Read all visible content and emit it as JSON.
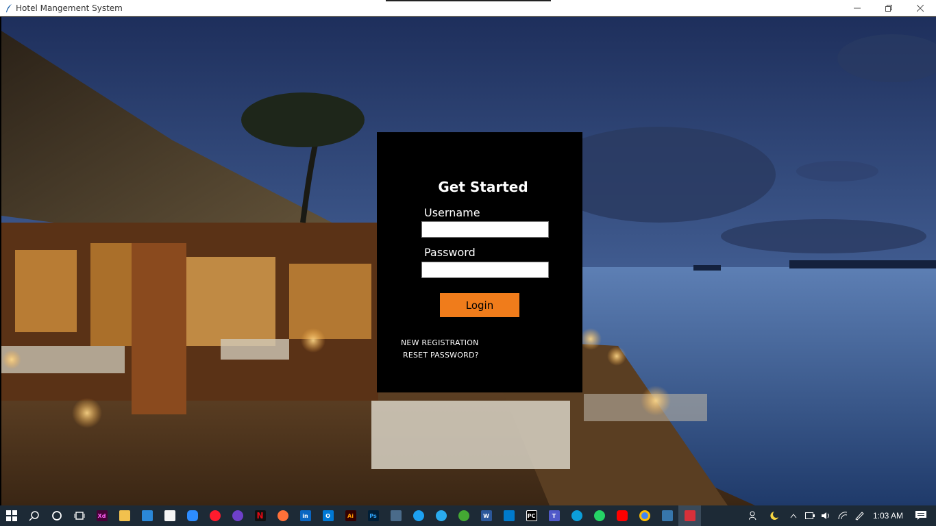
{
  "window": {
    "title": "Hotel Mangement System",
    "icon": "feather-icon"
  },
  "login": {
    "heading": "Get Started",
    "username_label": "Username",
    "username_value": "",
    "password_label": "Password",
    "password_value": "",
    "login_label": "Login",
    "new_registration_label": "NEW REGISTRATION",
    "reset_password_label": "RESET PASSWORD?"
  },
  "colors": {
    "panel_bg": "#000000",
    "login_button": "#f07c1b",
    "taskbar_bg": "#1d2a36"
  },
  "taskbar": {
    "clock": "1:03 AM",
    "icons": [
      "windows-start-icon",
      "search-icon",
      "cortana-icon",
      "task-view-icon",
      "adobe-xd-icon",
      "file-explorer-icon",
      "mail-icon",
      "store-icon",
      "zoom-icon",
      "opera-icon",
      "github-icon",
      "netflix-icon",
      "firefox-icon",
      "linkedin-icon",
      "outlook-icon",
      "illustrator-icon",
      "photoshop-icon",
      "sql-icon",
      "twitter-icon",
      "telegram-icon",
      "anaconda-icon",
      "word-icon",
      "vscode-icon",
      "pycharm-icon",
      "teams-icon",
      "edge-icon",
      "whatsapp-icon",
      "youtube-icon",
      "chrome-icon",
      "python-icon",
      "feather-app-icon"
    ]
  }
}
